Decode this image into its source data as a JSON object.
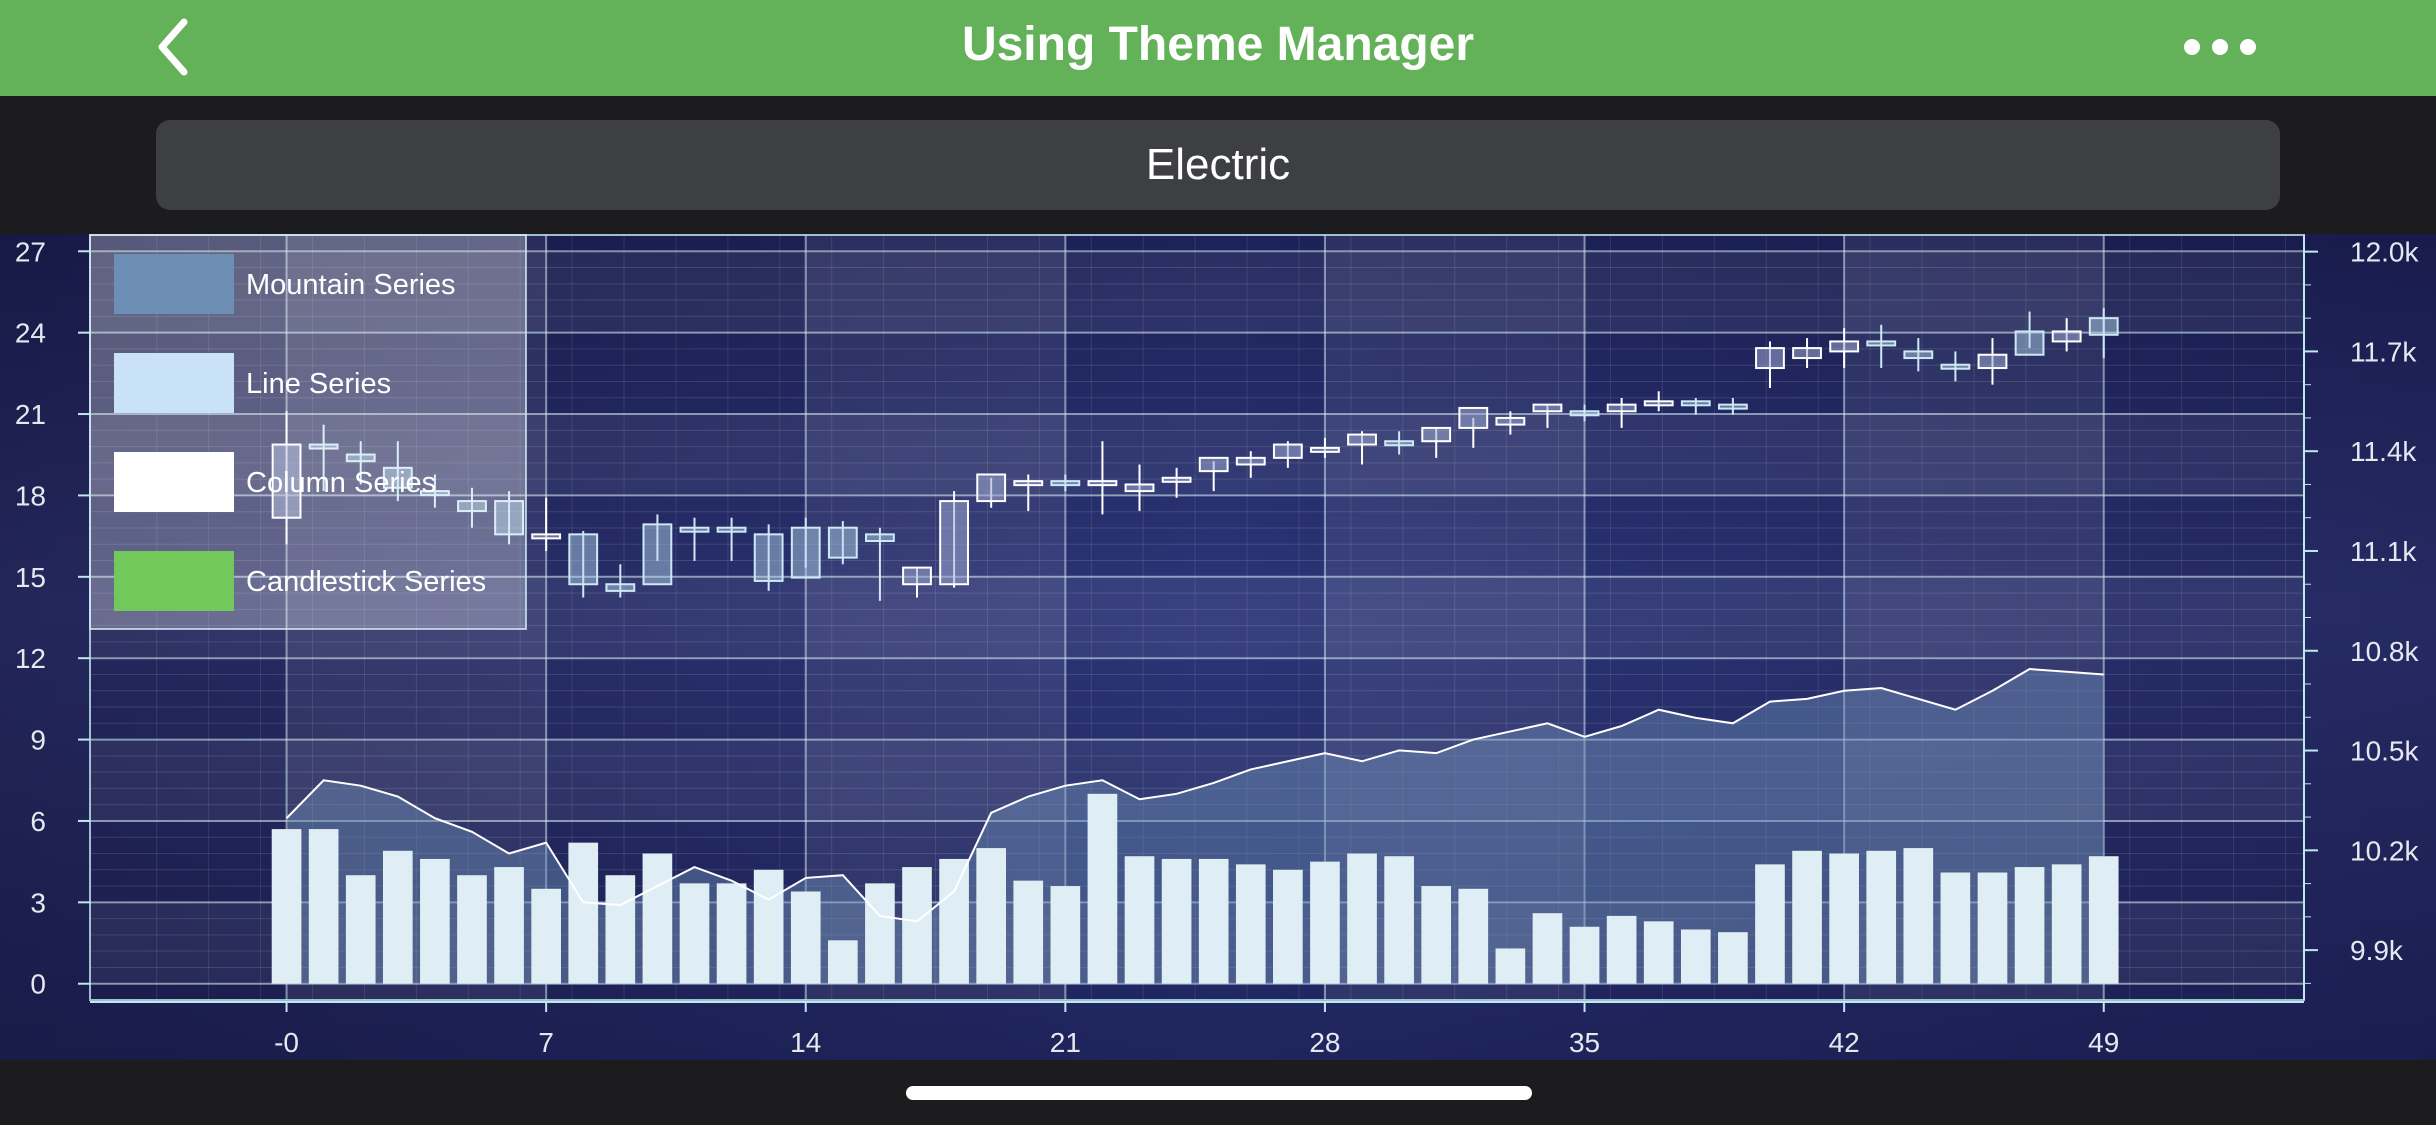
{
  "nav": {
    "title": "Using Theme Manager",
    "back_icon": "chevron-left-icon",
    "more_icon": "ellipsis-icon"
  },
  "theme_selector": {
    "value": "Electric"
  },
  "colors": {
    "nav_bar": "#63b25a",
    "mountain": "#6d8fb5",
    "line": "#c9e2f7",
    "column": "#ffffff",
    "candlestick": "#73c85c"
  },
  "chart_data": {
    "type": "multi-series",
    "legend": {
      "placement": "top-left",
      "items": [
        "Mountain Series",
        "Line Series",
        "Column Series",
        "Candlestick Series"
      ]
    },
    "x_axis": {
      "ticks": [
        "-0",
        "7",
        "14",
        "21",
        "28",
        "35",
        "42",
        "49"
      ],
      "range": [
        -5.3,
        54.4
      ]
    },
    "y_left": {
      "ticks": [
        "0",
        "3",
        "6",
        "9",
        "12",
        "15",
        "18",
        "21",
        "24",
        "27"
      ],
      "range": [
        -0.6,
        27.6
      ]
    },
    "y_right": {
      "ticks": [
        "9.9k",
        "10.2k",
        "10.5k",
        "10.8k",
        "11.1k",
        "11.4k",
        "11.7k",
        "12.0k"
      ],
      "range": [
        9750,
        12050
      ]
    },
    "grid": true,
    "column_series": {
      "x": [
        0,
        1,
        2,
        3,
        4,
        5,
        6,
        7,
        8,
        9,
        10,
        11,
        12,
        13,
        14,
        15,
        16,
        17,
        18,
        19,
        20,
        21,
        22,
        23,
        24,
        25,
        26,
        27,
        28,
        29,
        30,
        31,
        32,
        33,
        34,
        35,
        36,
        37,
        38,
        39,
        40,
        41,
        42,
        43,
        44,
        45,
        46,
        47,
        48,
        49
      ],
      "values": [
        5.7,
        5.7,
        4.0,
        4.9,
        4.6,
        4.0,
        4.3,
        3.5,
        5.2,
        4.0,
        4.8,
        3.7,
        3.7,
        4.2,
        3.4,
        1.6,
        3.7,
        4.3,
        4.6,
        5.0,
        3.8,
        3.6,
        7.0,
        4.7,
        4.6,
        4.6,
        4.4,
        4.2,
        4.5,
        4.8,
        4.7,
        3.6,
        3.5,
        1.3,
        2.6,
        2.1,
        2.5,
        2.3,
        2.0,
        1.9,
        4.4,
        4.9,
        4.8,
        4.9,
        5.0,
        4.1,
        4.1,
        4.3,
        4.4,
        4.7
      ]
    },
    "line_series": {
      "x": [
        0,
        1,
        2,
        3,
        4,
        5,
        6,
        7,
        8,
        9,
        10,
        11,
        12,
        13,
        14,
        15,
        16,
        17,
        18,
        19,
        20,
        21,
        22,
        23,
        24,
        25,
        26,
        27,
        28,
        29,
        30,
        31,
        32,
        33,
        34,
        35,
        36,
        37,
        38,
        39,
        40,
        41,
        42,
        43,
        44,
        45,
        46,
        47,
        48,
        49
      ],
      "values": [
        6.1,
        7.5,
        7.3,
        6.9,
        6.1,
        5.6,
        4.8,
        5.2,
        3.0,
        2.9,
        3.6,
        4.3,
        3.8,
        3.1,
        3.9,
        4.0,
        2.5,
        2.3,
        3.4,
        6.3,
        6.9,
        7.3,
        7.5,
        6.8,
        7.0,
        7.4,
        7.9,
        8.2,
        8.5,
        8.2,
        8.6,
        8.5,
        9.0,
        9.3,
        9.6,
        9.1,
        9.5,
        10.1,
        9.8,
        9.6,
        10.4,
        10.5,
        10.8,
        10.9,
        10.5,
        10.1,
        10.8,
        11.6,
        11.5,
        11.4
      ]
    },
    "mountain_series": {
      "x": [
        0,
        1,
        2,
        3,
        4,
        5,
        6,
        7,
        8,
        9,
        10,
        11,
        12,
        13,
        14,
        15,
        16,
        17,
        18,
        19,
        20,
        21,
        22,
        23,
        24,
        25,
        26,
        27,
        28,
        29,
        30,
        31,
        32,
        33,
        34,
        35,
        36,
        37,
        38,
        39,
        40,
        41,
        42,
        43,
        44,
        45,
        46,
        47,
        48,
        49
      ],
      "values": [
        6.1,
        7.5,
        7.3,
        6.9,
        6.1,
        5.6,
        4.8,
        5.2,
        3.0,
        2.9,
        3.6,
        4.3,
        3.8,
        3.1,
        3.9,
        4.0,
        2.5,
        2.3,
        3.4,
        6.3,
        6.9,
        7.3,
        7.5,
        6.8,
        7.0,
        7.4,
        7.9,
        8.2,
        8.5,
        8.2,
        8.6,
        8.5,
        9.0,
        9.3,
        9.6,
        9.1,
        9.5,
        10.1,
        9.8,
        9.6,
        10.4,
        10.5,
        10.8,
        10.9,
        10.5,
        10.1,
        10.8,
        11.6,
        11.5,
        11.4
      ]
    },
    "candlestick_series": {
      "x": [
        0,
        1,
        2,
        3,
        4,
        5,
        6,
        7,
        8,
        9,
        10,
        11,
        12,
        13,
        14,
        15,
        16,
        17,
        18,
        19,
        20,
        21,
        22,
        23,
        24,
        25,
        26,
        27,
        28,
        29,
        30,
        31,
        32,
        33,
        34,
        35,
        36,
        37,
        38,
        39,
        40,
        41,
        42,
        43,
        44,
        45,
        46,
        47,
        48,
        49
      ],
      "open": [
        11200,
        11420,
        11390,
        11350,
        11280,
        11250,
        11250,
        11150,
        11150,
        11000,
        11180,
        11170,
        11170,
        11150,
        11170,
        11170,
        11150,
        11000,
        11000,
        11250,
        11300,
        11310,
        11300,
        11280,
        11320,
        11340,
        11360,
        11380,
        11400,
        11420,
        11430,
        11430,
        11470,
        11480,
        11520,
        11520,
        11520,
        11540,
        11550,
        11540,
        11650,
        11680,
        11700,
        11730,
        11700,
        11660,
        11650,
        11760,
        11730,
        11800
      ],
      "high": [
        11520,
        11480,
        11430,
        11430,
        11330,
        11290,
        11280,
        11260,
        11160,
        11060,
        11210,
        11200,
        11200,
        11180,
        11200,
        11190,
        11170,
        11050,
        11280,
        11320,
        11330,
        11330,
        11430,
        11360,
        11350,
        11370,
        11400,
        11430,
        11440,
        11460,
        11460,
        11470,
        11500,
        11520,
        11540,
        11540,
        11560,
        11580,
        11560,
        11560,
        11730,
        11740,
        11770,
        11780,
        11740,
        11700,
        11740,
        11820,
        11800,
        11830
      ],
      "low": [
        11120,
        11280,
        11300,
        11250,
        11230,
        11170,
        11120,
        11100,
        10960,
        10960,
        11070,
        11070,
        11070,
        10980,
        11050,
        11060,
        10950,
        10960,
        10990,
        11230,
        11220,
        11280,
        11210,
        11220,
        11260,
        11280,
        11320,
        11350,
        11380,
        11360,
        11390,
        11380,
        11410,
        11450,
        11470,
        11490,
        11470,
        11520,
        11510,
        11510,
        11590,
        11650,
        11650,
        11650,
        11640,
        11610,
        11600,
        11710,
        11700,
        11680
      ],
      "close": [
        11420,
        11410,
        11370,
        11290,
        11270,
        11220,
        11150,
        11150,
        11000,
        10980,
        11000,
        11160,
        11160,
        11010,
        11020,
        11080,
        11130,
        11050,
        11250,
        11330,
        11310,
        11300,
        11310,
        11300,
        11320,
        11380,
        11380,
        11420,
        11410,
        11450,
        11420,
        11470,
        11530,
        11500,
        11540,
        11510,
        11540,
        11550,
        11540,
        11530,
        11710,
        11710,
        11730,
        11720,
        11680,
        11650,
        11690,
        11690,
        11760,
        11750
      ]
    }
  }
}
